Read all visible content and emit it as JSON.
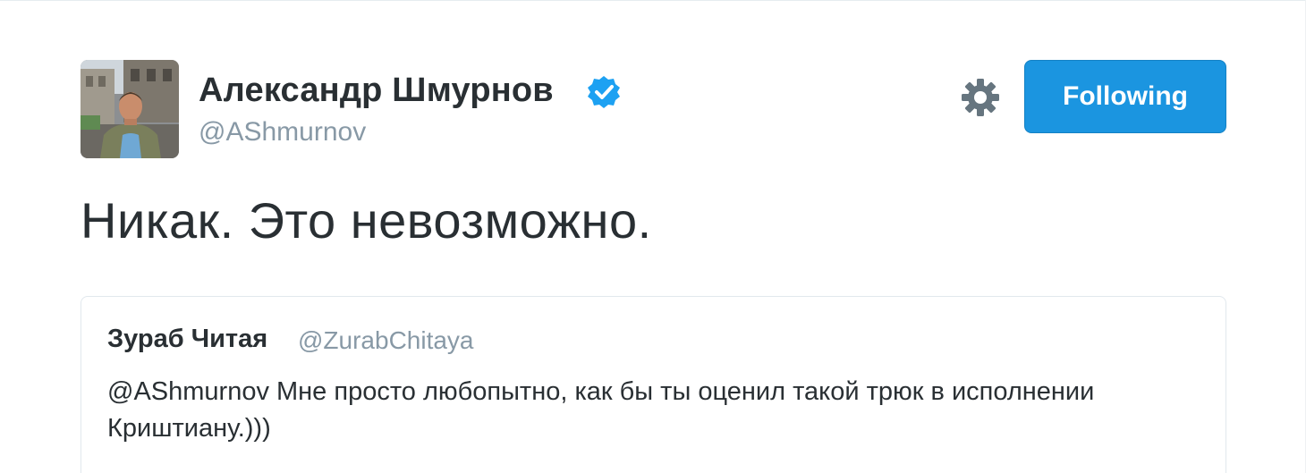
{
  "author": {
    "display_name": "Александр Шмурнов",
    "screen_name": "@AShmurnov",
    "verified": true,
    "avatar_icon": "avatar-photo"
  },
  "actions": {
    "settings_icon": "gear-icon",
    "follow_label": "Following",
    "follow_color": "#1b95e0"
  },
  "tweet": {
    "text": "Никак. Это невозможно."
  },
  "quoted_tweet": {
    "display_name": "Зураб Читая",
    "screen_name": "@ZurabChitaya",
    "text": "@AShmurnov Мне просто любопытно, как бы ты оценил такой трюк в исполнении Криштиану.)))"
  },
  "colors": {
    "text": "#292f33",
    "secondary": "#8899a6",
    "verified_badge": "#1da1f2",
    "border": "#e1e8ed"
  }
}
